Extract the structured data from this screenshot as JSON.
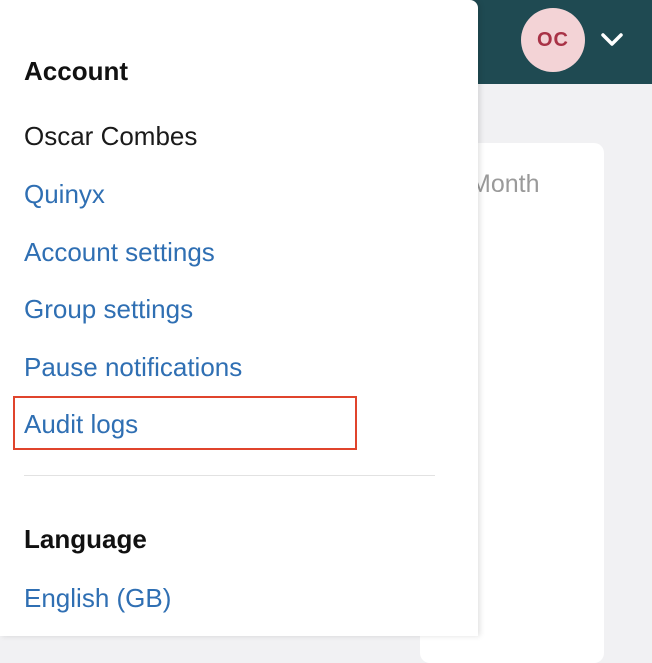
{
  "header": {
    "avatar_initials": "OC",
    "colors": {
      "bar": "#1f4a52",
      "avatar_bg": "#f3d3d6",
      "avatar_text": "#a83246"
    },
    "menu_icon": "chevron-down-icon"
  },
  "background": {
    "card_label": "Month"
  },
  "menu": {
    "account_heading": "Account",
    "user_name": "Oscar Combes",
    "items": [
      {
        "label": "Quinyx"
      },
      {
        "label": "Account settings"
      },
      {
        "label": "Group settings"
      },
      {
        "label": "Pause notifications"
      },
      {
        "label": "Audit logs",
        "highlighted": true
      }
    ],
    "language_heading": "Language",
    "language_value": "English (GB)",
    "colors": {
      "link": "#2f6fb3",
      "highlight_border": "#e0442c"
    }
  }
}
